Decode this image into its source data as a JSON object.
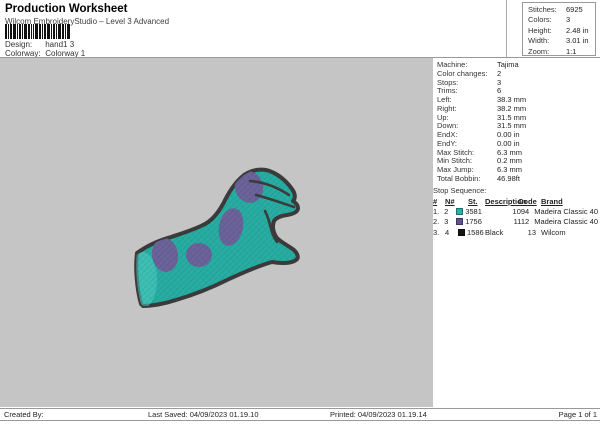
{
  "header": {
    "title": "Production Worksheet",
    "subtitle": "Wilcom EmbroideryStudio – Level 3 Advanced",
    "design_label": "Design:",
    "design_value": "hand1 3",
    "colorway_label": "Colorway:",
    "colorway_value": "Colorway 1"
  },
  "summary_box": {
    "rows": [
      {
        "label": "Stitches:",
        "value": "6925"
      },
      {
        "label": "Colors:",
        "value": "3"
      },
      {
        "label": "Height:",
        "value": "2.48 in"
      },
      {
        "label": "Width:",
        "value": "3.01 in"
      },
      {
        "label": "Zoom:",
        "value": "1:1"
      }
    ]
  },
  "machine_info": {
    "rows": [
      {
        "label": "Machine:",
        "value": "Tajima"
      },
      {
        "label": "Color changes:",
        "value": "2"
      },
      {
        "label": "Stops:",
        "value": "3"
      },
      {
        "label": "Trims:",
        "value": "6"
      },
      {
        "label": "Left:",
        "value": "38.3 mm"
      },
      {
        "label": "Right:",
        "value": "38.2 mm"
      },
      {
        "label": "Up:",
        "value": "31.5 mm"
      },
      {
        "label": "Down:",
        "value": "31.5 mm"
      },
      {
        "label": "EndX:",
        "value": "0.00 in"
      },
      {
        "label": "EndY:",
        "value": "0.00 in"
      },
      {
        "label": "Max Stitch:",
        "value": "6.3 mm"
      },
      {
        "label": "Min Stitch:",
        "value": "0.2 mm"
      },
      {
        "label": "Max Jump:",
        "value": "6.3 mm"
      },
      {
        "label": "Total Bobbin:",
        "value": "46.98ft"
      }
    ]
  },
  "stop_sequence": {
    "title": "Stop Sequence:",
    "headers": {
      "num": "#",
      "n": "N#",
      "st": "St.",
      "description": "Description",
      "code": "Code",
      "brand": "Brand"
    },
    "rows": [
      {
        "num": "1.",
        "n": "2",
        "swatch_color": "#2ab1a7",
        "st": "3581",
        "description": "",
        "code": "1094",
        "brand": "Madeira Classic 40"
      },
      {
        "num": "2.",
        "n": "3",
        "swatch_color": "#5c5394",
        "st": "1756",
        "description": "",
        "code": "1112",
        "brand": "Madeira Classic 40"
      },
      {
        "num": "3.",
        "n": "4",
        "swatch_color": "#161616",
        "st": "1586",
        "description": "Black",
        "code": "13",
        "brand": "Wilcom"
      }
    ]
  },
  "design": {
    "name": "hand1 3 embroidery preview",
    "colors": {
      "fill": "#28ada3",
      "fill_light": "#4ecec2",
      "spots": "#6b639a",
      "outline": "#3b3b3b",
      "canvas": "#c4c5c4"
    }
  },
  "footer": {
    "created_by": "Created By:",
    "last_saved": "Last Saved: 04/09/2023 01.19.10",
    "printed": "Printed: 04/09/2023 01.19.14",
    "page": "Page 1 of 1"
  }
}
